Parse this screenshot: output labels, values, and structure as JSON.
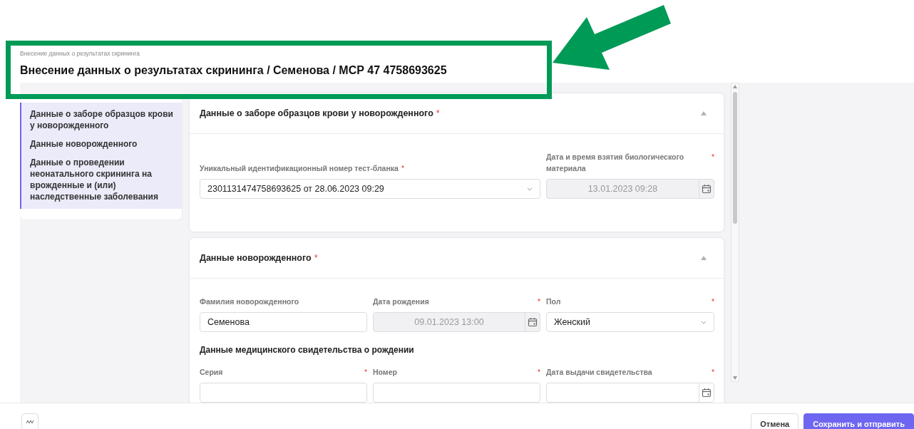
{
  "header": {
    "breadcrumb": "Внесение данных о результатах скрининга",
    "title": "Внесение данных о результатах скрининга / Семенова / МСР 47 4758693625"
  },
  "sidebar": {
    "items": [
      {
        "label": "Данные о заборе образцов крови у новорожденного"
      },
      {
        "label": "Данные новорожденного"
      },
      {
        "label": "Данные о проведении неонатального скрининга на врожденные и (или) наследственные заболевания"
      }
    ]
  },
  "sections": [
    {
      "title": "Данные о заборе образцов крови у новорожденного",
      "required_mark": "*",
      "expanded": true,
      "blocks": [
        {
          "kind": "fields",
          "fields": [
            {
              "kind": "select",
              "label": "Уникальный идентификационный номер тест-бланка",
              "required_mark": "*",
              "value": "2301131474758693625 от 28.06.2023 09:29",
              "wide": true
            },
            {
              "kind": "date",
              "label": "Дата и время взятия биологического материала",
              "required_mark": "*",
              "value": "13.01.2023 09:28",
              "disabled": true
            }
          ]
        }
      ]
    },
    {
      "title": "Данные новорожденного",
      "required_mark": "*",
      "expanded": true,
      "blocks": [
        {
          "kind": "fields",
          "fields": [
            {
              "kind": "text",
              "label": "Фамилия новорожденного",
              "value": "Семенова"
            },
            {
              "kind": "date",
              "label": "Дата рождения",
              "required_mark": "*",
              "value": "09.01.2023 13:00",
              "disabled": true
            },
            {
              "kind": "select",
              "label": "Пол",
              "required_mark": "*",
              "value": "Женский"
            }
          ]
        },
        {
          "kind": "subheading",
          "text": "Данные медицинского свидетельства о рождении"
        },
        {
          "kind": "fields",
          "fields": [
            {
              "kind": "text",
              "label": "Серия",
              "required_mark": "*"
            },
            {
              "kind": "text",
              "label": "Номер",
              "required_mark": "*"
            },
            {
              "kind": "date",
              "label": "Дата выдачи свидетельства",
              "required_mark": "*"
            }
          ]
        }
      ]
    }
  ],
  "footer": {
    "buttons": [
      {
        "kind": "secondary",
        "label": "Отмена"
      },
      {
        "kind": "primary",
        "label": "Сохранить и отправить"
      }
    ]
  }
}
